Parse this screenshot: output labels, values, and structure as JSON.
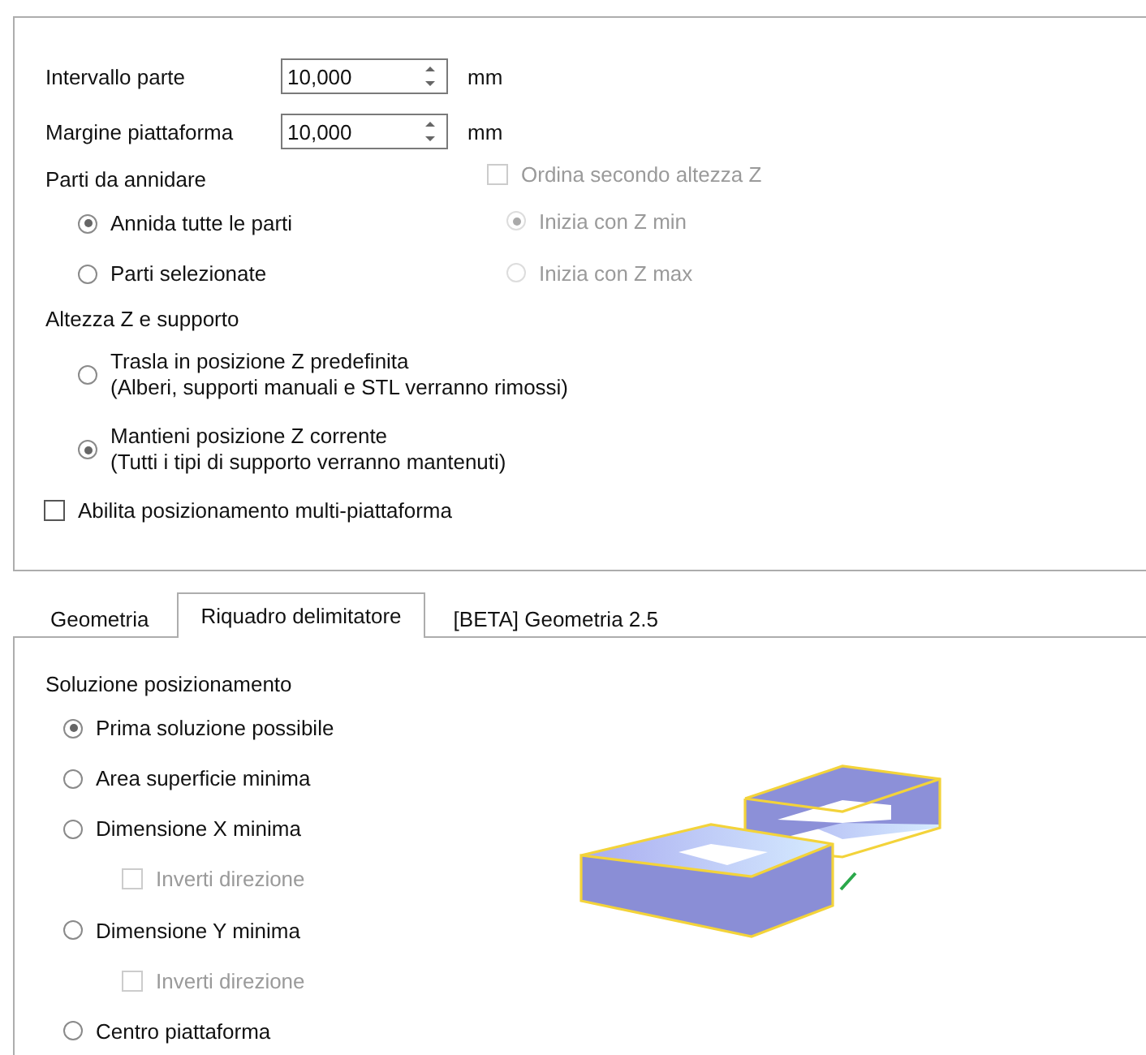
{
  "spinners": [
    {
      "label": "Intervallo parte",
      "value": "10,000",
      "unit": "mm"
    },
    {
      "label": "Margine piattaforma",
      "value": "10,000",
      "unit": "mm"
    }
  ],
  "nest_parts": {
    "label": "Parti da annidare",
    "options": [
      {
        "label": "Annida tutte le parti",
        "selected": true
      },
      {
        "label": "Parti selezionate",
        "selected": false
      }
    ]
  },
  "sort_by_z": {
    "label": "Ordina secondo altezza Z",
    "checked": false,
    "disabled": true,
    "options": [
      {
        "label": "Inizia con Z min",
        "selected": true
      },
      {
        "label": "Inizia con Z max",
        "selected": false
      }
    ]
  },
  "z_height": {
    "label": "Altezza Z e supporto",
    "options": [
      {
        "lines": [
          "Trasla in posizione Z predefinita",
          "(Alberi, supporti manuali e STL verranno rimossi)"
        ],
        "selected": false
      },
      {
        "lines": [
          "Mantieni posizione Z corrente",
          "(Tutti i tipi di supporto verranno mantenuti)"
        ],
        "selected": true
      }
    ]
  },
  "multi_platform": {
    "label": "Abilita posizionamento multi-piattaforma",
    "checked": false
  },
  "tabs": [
    {
      "label": "Geometria",
      "selected": false
    },
    {
      "label": "Riquadro delimitatore",
      "selected": true
    },
    {
      "label": "[BETA] Geometria 2.5",
      "selected": false
    }
  ],
  "placement": {
    "label": "Soluzione posizionamento",
    "items": [
      {
        "kind": "radio",
        "label": "Prima soluzione possibile",
        "selected": true
      },
      {
        "kind": "radio",
        "label": "Area superficie minima",
        "selected": false
      },
      {
        "kind": "radio",
        "label": "Dimensione X minima",
        "selected": false
      },
      {
        "kind": "checkbox",
        "label": "Inverti direzione",
        "checked": false,
        "disabled": true
      },
      {
        "kind": "radio",
        "label": "Dimensione Y minima",
        "selected": false
      },
      {
        "kind": "checkbox",
        "label": "Inverti direzione",
        "checked": false,
        "disabled": true
      },
      {
        "kind": "radio",
        "label": "Centro piattaforma",
        "selected": false
      }
    ]
  }
}
